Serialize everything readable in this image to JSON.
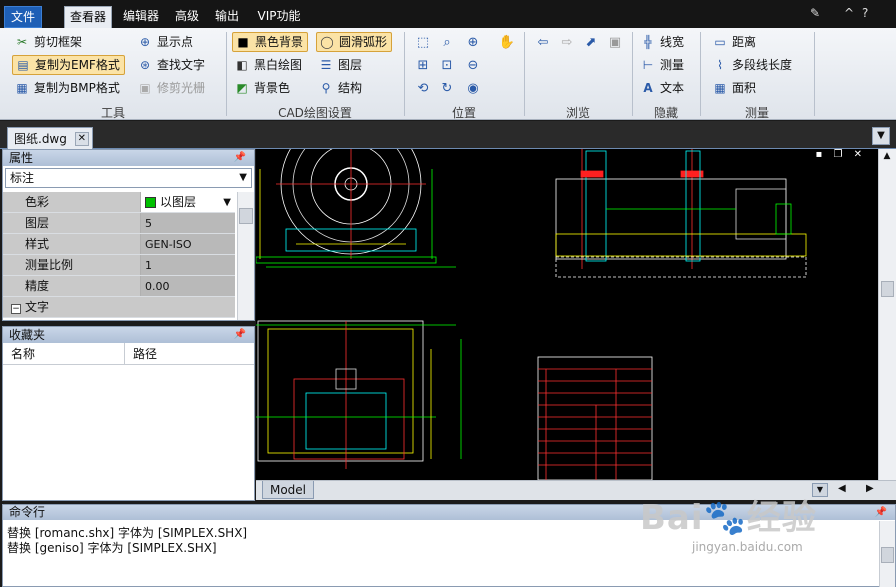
{
  "menu": {
    "tabs": [
      {
        "label": "文件",
        "state": "file"
      },
      {
        "label": "查看器",
        "state": "active"
      },
      {
        "label": "编辑器",
        "state": "normal"
      },
      {
        "label": "高级",
        "state": "normal"
      },
      {
        "label": "输出",
        "state": "normal"
      },
      {
        "label": "VIP功能",
        "state": "normal"
      }
    ]
  },
  "ribbon": {
    "tools": {
      "clip_frame": "剪切框架",
      "copy_emf": "复制为EMF格式",
      "copy_bmp": "复制为BMP格式",
      "show_points": "显示点",
      "find_text": "查找文字",
      "trim_raster": "修剪光栅",
      "group": "工具"
    },
    "cad": {
      "black_bg": "黑色背景",
      "bw_draw": "黑白绘图",
      "bg_color": "背景色",
      "smooth_arc": "圆滑弧形",
      "layers": "图层",
      "structure": "结构",
      "group": "CAD绘图设置"
    },
    "position": {
      "group": "位置"
    },
    "browse": {
      "group": "浏览"
    },
    "hide": {
      "lineweight": "线宽",
      "measure": "测量",
      "text": "文本",
      "group": "隐藏"
    },
    "measure": {
      "distance": "距离",
      "polyline_length": "多段线长度",
      "area": "面积",
      "group": "测量"
    }
  },
  "document": {
    "tab_label": "图纸.dwg"
  },
  "properties": {
    "title": "属性",
    "category": "标注",
    "rows": [
      {
        "key": "色彩",
        "value": "以图层",
        "swatch": "#00c000"
      },
      {
        "key": "图层",
        "value": "5"
      },
      {
        "key": "样式",
        "value": "GEN-ISO"
      },
      {
        "key": "测量比例",
        "value": "1"
      },
      {
        "key": "精度",
        "value": "0.00"
      },
      {
        "key": "文字",
        "value": "",
        "section": true
      }
    ]
  },
  "favorites": {
    "title": "收藏夹",
    "col_name": "名称",
    "col_path": "路径"
  },
  "canvas": {
    "model_tab": "Model"
  },
  "command": {
    "title": "命令行",
    "lines": [
      "替换 [romanc.shx] 字体为 [SIMPLEX.SHX]",
      "替换 [geniso] 字体为 [SIMPLEX.SHX]"
    ]
  },
  "watermark": {
    "brand": "Bai",
    "brand2": "经验",
    "url": "jingyan.baidu.com"
  }
}
